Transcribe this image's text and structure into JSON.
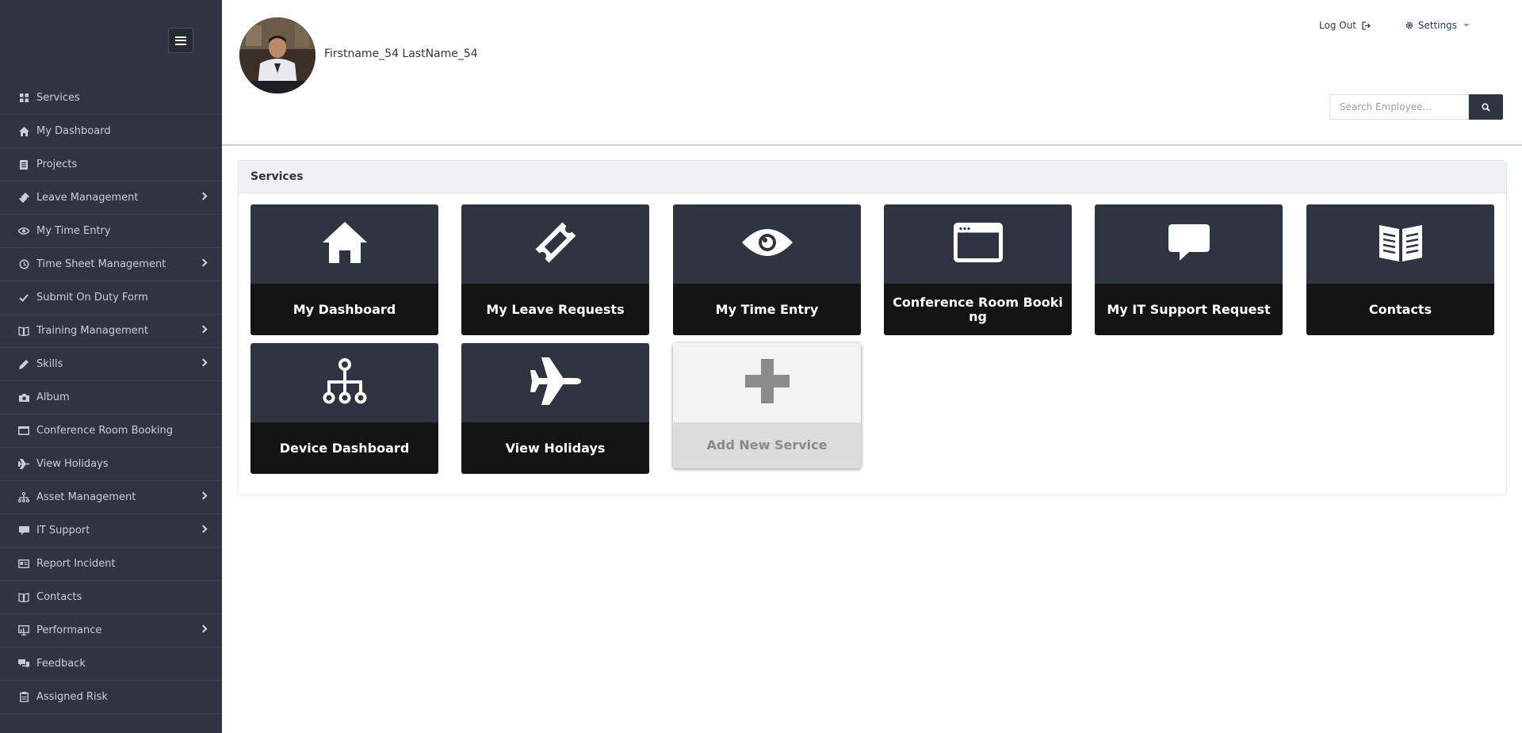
{
  "sidebar": {
    "items": [
      {
        "label": "Services",
        "icon": "grid-icon",
        "submenu": false
      },
      {
        "label": "My Dashboard",
        "icon": "home-icon",
        "submenu": false
      },
      {
        "label": "Projects",
        "icon": "document-icon",
        "submenu": false
      },
      {
        "label": "Leave Management",
        "icon": "ticket-icon",
        "submenu": true
      },
      {
        "label": "My Time Entry",
        "icon": "eye-icon",
        "submenu": false
      },
      {
        "label": "Time Sheet Management",
        "icon": "history-icon",
        "submenu": true
      },
      {
        "label": "Submit On Duty Form",
        "icon": "check-icon",
        "submenu": false
      },
      {
        "label": "Training Management",
        "icon": "book-icon",
        "submenu": true
      },
      {
        "label": "Skills",
        "icon": "pencil-icon",
        "submenu": true
      },
      {
        "label": "Album",
        "icon": "camera-icon",
        "submenu": false
      },
      {
        "label": "Conference Room Booking",
        "icon": "window-icon",
        "submenu": false
      },
      {
        "label": "View Holidays",
        "icon": "plane-icon",
        "submenu": false
      },
      {
        "label": "Asset Management",
        "icon": "sitemap-icon",
        "submenu": true
      },
      {
        "label": "IT Support",
        "icon": "comment-icon",
        "submenu": true
      },
      {
        "label": "Report Incident",
        "icon": "id-card-icon",
        "submenu": false
      },
      {
        "label": "Contacts",
        "icon": "book-icon",
        "submenu": false
      },
      {
        "label": "Performance",
        "icon": "presentation-icon",
        "submenu": true
      },
      {
        "label": "Feedback",
        "icon": "comments-icon",
        "submenu": false
      },
      {
        "label": "Assigned Risk",
        "icon": "clipboard-icon",
        "submenu": false
      }
    ]
  },
  "header": {
    "username": "Firstname_54 LastName_54",
    "logout_label": "Log Out",
    "settings_label": "Settings",
    "search_placeholder": "Search Employee..."
  },
  "panel": {
    "title": "Services",
    "tiles": [
      {
        "label": "My Dashboard",
        "icon": "home-icon"
      },
      {
        "label": "My Leave Requests",
        "icon": "ticket-icon"
      },
      {
        "label": "My Time Entry",
        "icon": "eye-icon"
      },
      {
        "label": "Conference Room Booki ng",
        "icon": "window-icon"
      },
      {
        "label": "My IT Support Request",
        "icon": "comment-icon"
      },
      {
        "label": "Contacts",
        "icon": "book-open-icon"
      },
      {
        "label": "Device Dashboard",
        "icon": "sitemap-icon"
      },
      {
        "label": "View Holidays",
        "icon": "plane-icon"
      },
      {
        "label": "Add New Service",
        "icon": "plus-icon"
      }
    ]
  },
  "colors": {
    "sidebar_bg": "#2f3540",
    "tile_top": "#2f3540",
    "tile_bottom": "#141414",
    "link": "#2a3c5a"
  }
}
